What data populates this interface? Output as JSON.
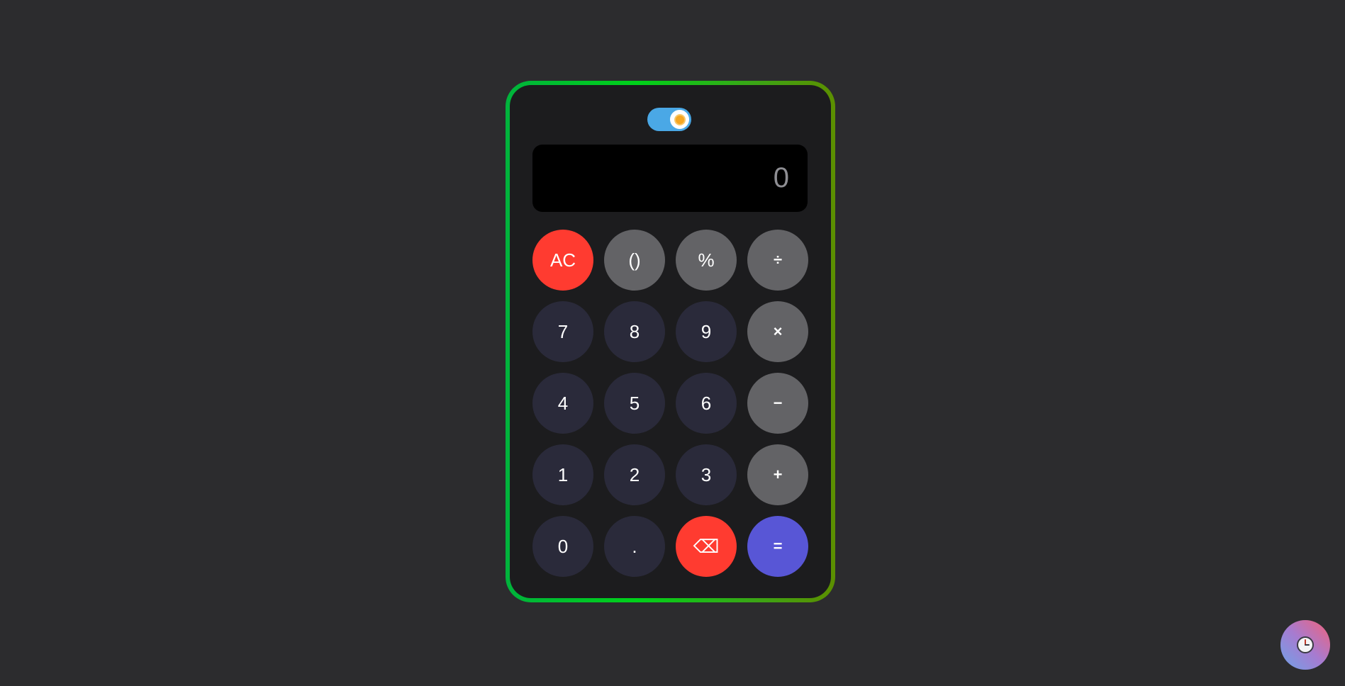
{
  "theme_toggle": {
    "state": "on",
    "icon": "sun-icon"
  },
  "display": {
    "value": "0"
  },
  "keypad": {
    "keys": [
      {
        "label": "AC",
        "name": "clear-button",
        "style": "danger"
      },
      {
        "label": "()",
        "name": "parentheses-button",
        "style": "op"
      },
      {
        "label": "%",
        "name": "percent-button",
        "style": "op"
      },
      {
        "label": "÷",
        "name": "divide-button",
        "style": "op"
      },
      {
        "label": "7",
        "name": "digit-7-button",
        "style": "num"
      },
      {
        "label": "8",
        "name": "digit-8-button",
        "style": "num"
      },
      {
        "label": "9",
        "name": "digit-9-button",
        "style": "num"
      },
      {
        "label": "×",
        "name": "multiply-button",
        "style": "op"
      },
      {
        "label": "4",
        "name": "digit-4-button",
        "style": "num"
      },
      {
        "label": "5",
        "name": "digit-5-button",
        "style": "num"
      },
      {
        "label": "6",
        "name": "digit-6-button",
        "style": "num"
      },
      {
        "label": "−",
        "name": "subtract-button",
        "style": "op"
      },
      {
        "label": "1",
        "name": "digit-1-button",
        "style": "num"
      },
      {
        "label": "2",
        "name": "digit-2-button",
        "style": "num"
      },
      {
        "label": "3",
        "name": "digit-3-button",
        "style": "num"
      },
      {
        "label": "+",
        "name": "add-button",
        "style": "op"
      },
      {
        "label": "0",
        "name": "digit-0-button",
        "style": "num"
      },
      {
        "label": ".",
        "name": "decimal-button",
        "style": "num"
      },
      {
        "label": "⌫",
        "name": "backspace-button",
        "style": "danger"
      },
      {
        "label": "=",
        "name": "equals-button",
        "style": "accent"
      }
    ]
  },
  "history_button": {
    "icon": "clock-icon"
  },
  "colors": {
    "page_background": "#2c2c2e",
    "calculator_body": "#1c1c1e",
    "border_gradient": [
      "#00b33c",
      "#00d11a",
      "#5c8f00"
    ],
    "number_key": "#2a2a3a",
    "operator_key": "#636366",
    "danger_key": "#ff3b30",
    "equals_key": "#5856d6",
    "toggle_track": "#4aa8e6"
  }
}
